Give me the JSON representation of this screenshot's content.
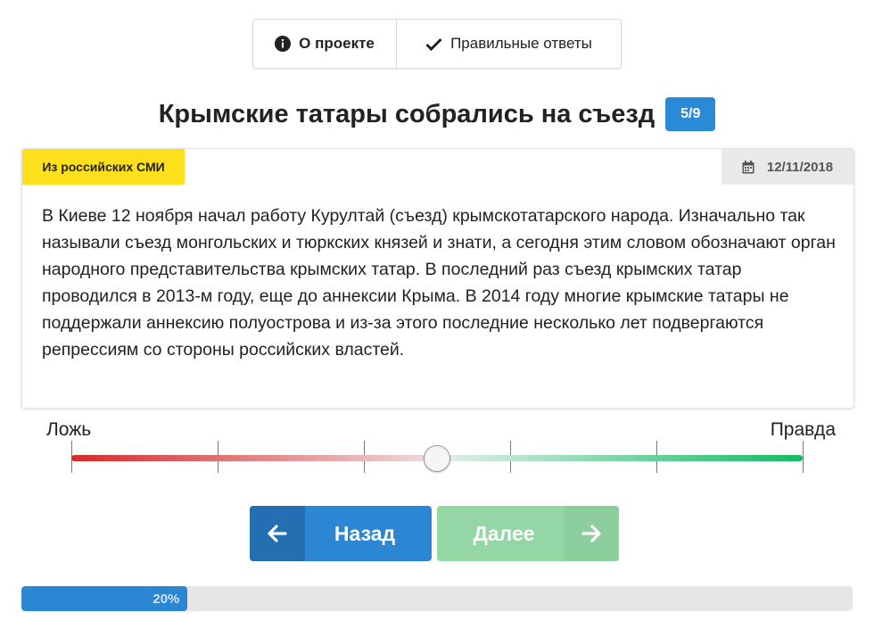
{
  "topbar": {
    "about": {
      "label": "О проекте",
      "icon": "info-circle-icon"
    },
    "answers": {
      "label": "Правильные ответы",
      "icon": "check-icon"
    }
  },
  "question": {
    "title": "Крымские татары собрались на съезд",
    "counter": "5/9"
  },
  "card": {
    "source": "Из российских СМИ",
    "date": "12/11/2018",
    "date_icon": "calendar-icon",
    "text": "В Киеве 12 ноября начал работу Курултай (съезд) крымскотатарского народа. Изначально так называли съезд монгольских и тюркских князей и знати, а сегодня этим словом обозначают орган народного представительства крымских татар. В последний раз съезд крымских татар проводился в 2013-м году, еще до аннексии Крыма. В 2014 году многие крымские татары не поддержали аннексию полуострова и из-за этого последние несколько лет подвергаются репрессиям со стороны российских властей."
  },
  "slider": {
    "label_false": "Ложь",
    "label_true": "Правда",
    "value": 0.5,
    "ticks": 6,
    "color_false": "#d62a2a",
    "color_true": "#12bb62"
  },
  "buttons": {
    "back": {
      "label": "Назад",
      "icon": "arrow-left-icon"
    },
    "next": {
      "label": "Далее",
      "icon": "arrow-right-icon"
    }
  },
  "progress": {
    "value": 0.2,
    "label": "20%"
  },
  "colors": {
    "accent": "#2b87d3",
    "source_tag": "#ffe01b",
    "next_disabled": "#94d6a4"
  }
}
